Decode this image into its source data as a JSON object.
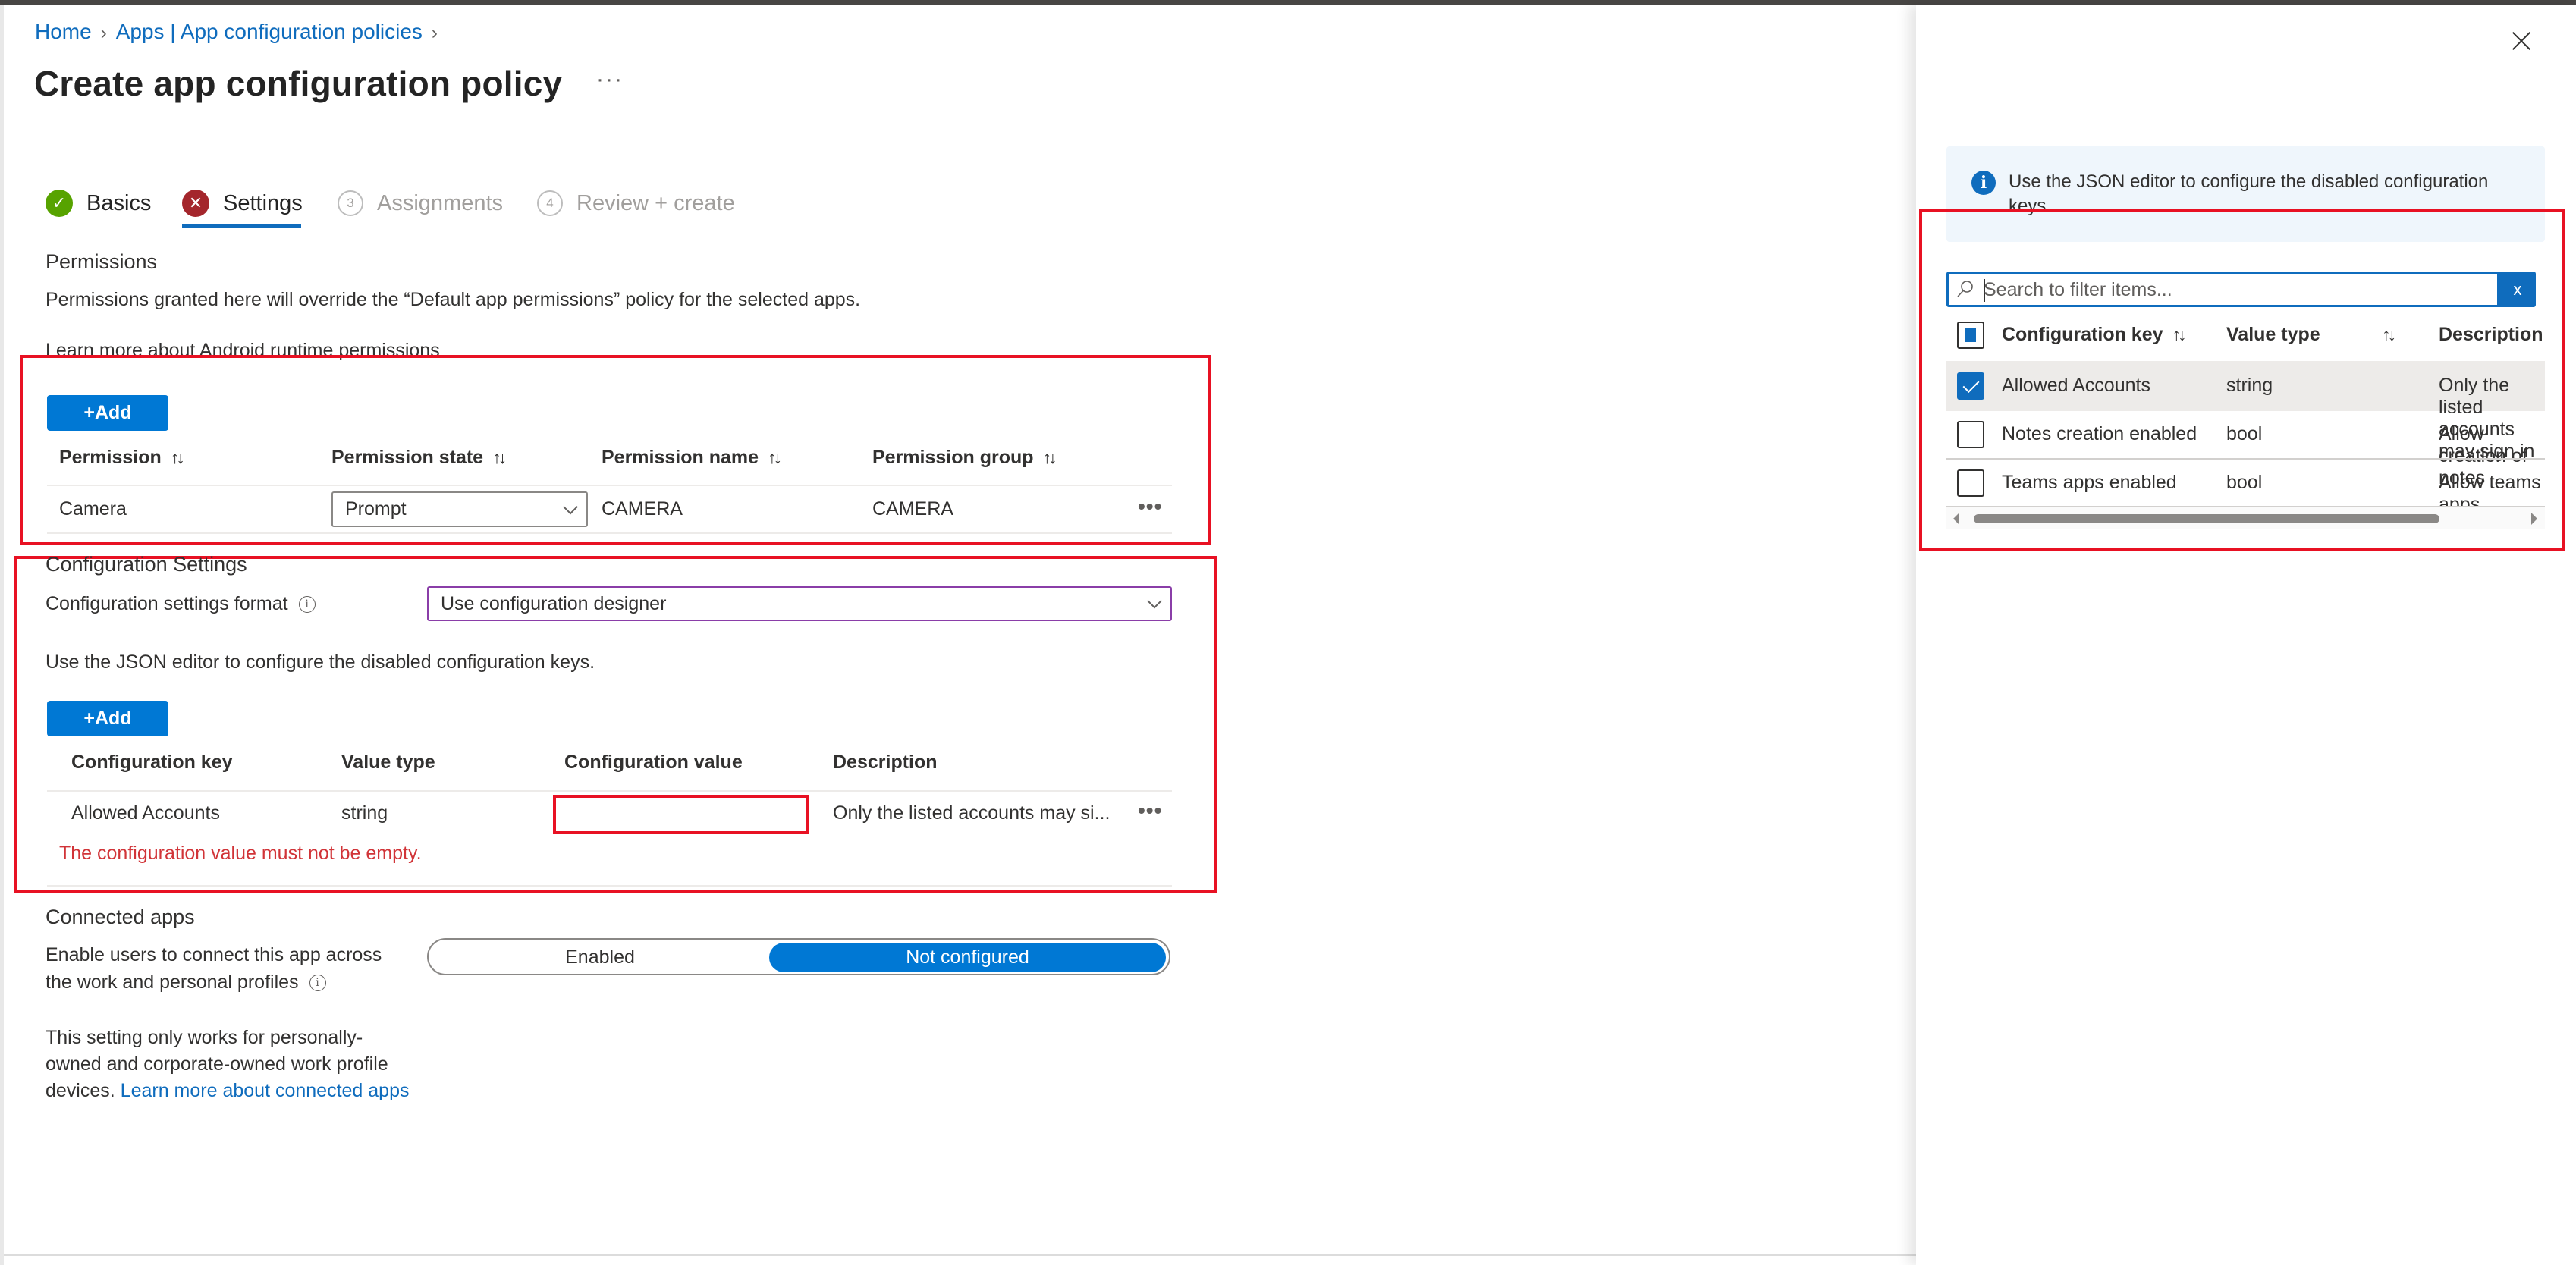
{
  "breadcrumb": {
    "items": [
      "Home",
      "Apps | App configuration policies"
    ],
    "separator": "›"
  },
  "page": {
    "title": "Create app configuration policy",
    "more_label": "···"
  },
  "wizard": {
    "steps": [
      {
        "label": "Basics",
        "state": "complete",
        "marker": "✓"
      },
      {
        "label": "Settings",
        "state": "error",
        "marker": "✕"
      },
      {
        "label": "Assignments",
        "state": "pending",
        "marker": "3"
      },
      {
        "label": "Review + create",
        "state": "pending",
        "marker": "4"
      }
    ],
    "active_step": "Settings"
  },
  "permissions": {
    "heading": "Permissions",
    "description": "Permissions granted here will override the “Default app permissions” policy for the selected apps.",
    "learn_more_link": "Learn more about Android runtime permissions",
    "add_button": "+Add",
    "sort_icon": "↑↓",
    "columns": [
      "Permission",
      "Permission state",
      "Permission name",
      "Permission group"
    ],
    "rows": [
      {
        "permission": "Camera",
        "state": "Prompt",
        "name": "CAMERA",
        "group": "CAMERA",
        "more": "•••"
      }
    ]
  },
  "configuration": {
    "heading": "Configuration Settings",
    "format_label": "Configuration settings format",
    "format_value": "Use configuration designer",
    "json_note": "Use the JSON editor to configure the disabled configuration keys.",
    "add_button": "+Add",
    "columns": [
      "Configuration key",
      "Value type",
      "Configuration value",
      "Description"
    ],
    "rows": [
      {
        "key": "Allowed Accounts",
        "type": "string",
        "value": "",
        "description": "Only the listed accounts may si...",
        "more": "•••"
      }
    ],
    "error": "The configuration value must not be empty."
  },
  "connected_apps": {
    "heading": "Connected apps",
    "label_line1": "Enable users to connect this app across",
    "label_line2": "the work and personal profiles",
    "options": [
      "Enabled",
      "Not configured"
    ],
    "selected": "Not configured",
    "note_line1": "This setting only works for personally-",
    "note_line2": "owned and corporate-owned work profile",
    "note_line3_prefix": "devices. ",
    "note_link": "Learn more about connected apps"
  },
  "side_panel": {
    "close_label": "×",
    "info_message": "Use the JSON editor to configure the disabled configuration keys.",
    "search": {
      "placeholder": "Search to filter items...",
      "value": "",
      "clear_label": "x"
    },
    "sort_icon": "↑↓",
    "columns": [
      "Configuration key",
      "Value type",
      "Description"
    ],
    "select_all_state": "partial",
    "rows": [
      {
        "key": "Allowed Accounts",
        "type": "string",
        "description": "Only the listed accounts may sign in",
        "checked": true
      },
      {
        "key": "Notes creation enabled",
        "type": "bool",
        "description": "Allow creation of notes",
        "checked": false
      },
      {
        "key": "Teams apps enabled",
        "type": "bool",
        "description": "Allow teams apps",
        "checked": false
      }
    ]
  },
  "colors": {
    "accent": "#0078d4",
    "link": "#0f6cbd",
    "error": "#d13438",
    "annotation_red": "#e81123",
    "success": "#57a300",
    "step_error": "#a4262c"
  }
}
